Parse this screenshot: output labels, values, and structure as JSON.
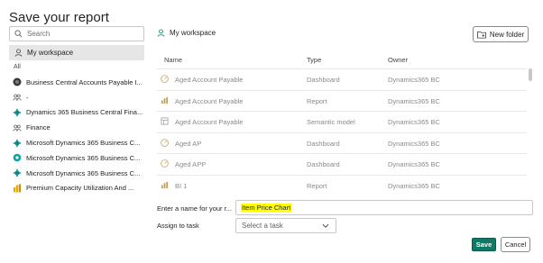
{
  "dialog": {
    "title": "Save your report"
  },
  "search": {
    "placeholder": "Search"
  },
  "sidebar": {
    "my_workspace": "My workspace",
    "all_label": "All",
    "workspaces": [
      {
        "label": "Business Central Accounts Payable I...",
        "icon": "dark-circle-icon",
        "color": "#3a3a3a"
      },
      {
        "label": "-",
        "icon": "people-group-icon",
        "color": "#616161"
      },
      {
        "label": "Dynamics 365 Business Central Fina...",
        "icon": "teal-dot-icon",
        "color": "#0f8a8a"
      },
      {
        "label": "Finance",
        "icon": "people-group-icon",
        "color": "#616161"
      },
      {
        "label": "Microsoft Dynamics 365 Business C...",
        "icon": "teal-dot-icon",
        "color": "#0f8a8a"
      },
      {
        "label": "Microsoft Dynamics 365 Business C...",
        "icon": "teal-lifebuoy-icon",
        "color": "#0aa3a3"
      },
      {
        "label": "Microsoft Dynamics 365 Business C...",
        "icon": "teal-dot-icon",
        "color": "#0f8a8a"
      },
      {
        "label": "Premium Capacity Utilization And ...",
        "icon": "yellow-bars-icon",
        "color": "#e8a800"
      }
    ]
  },
  "breadcrumb": {
    "label": "My workspace"
  },
  "toolbar": {
    "new_folder_label": "New folder"
  },
  "table": {
    "columns": [
      "Name",
      "Type",
      "Owner"
    ],
    "rows": [
      {
        "name": "Aged Account Payable",
        "type": "Dashboard",
        "owner": "Dynamics365 BC",
        "icon": "dashboard-icon"
      },
      {
        "name": "Aged Account Payable",
        "type": "Report",
        "owner": "Dynamics365 BC",
        "icon": "report-icon"
      },
      {
        "name": "Aged Account Payable",
        "type": "Semantic model",
        "owner": "Dynamics365 BC",
        "icon": "semantic-model-icon"
      },
      {
        "name": "Aged AP",
        "type": "Dashboard",
        "owner": "Dynamics365 BC",
        "icon": "dashboard-icon"
      },
      {
        "name": "Aged APP",
        "type": "Dashboard",
        "owner": "Dynamics365 BC",
        "icon": "dashboard-icon"
      },
      {
        "name": "BI 1",
        "type": "Report",
        "owner": "Dynamics365 BC",
        "icon": "report-icon"
      }
    ]
  },
  "form": {
    "name_label": "Enter a name for your r...",
    "name_value": "Item Price Chart",
    "task_label": "Assign to task",
    "task_placeholder": "Select a task"
  },
  "footer": {
    "save_label": "Save",
    "cancel_label": "Cancel"
  }
}
